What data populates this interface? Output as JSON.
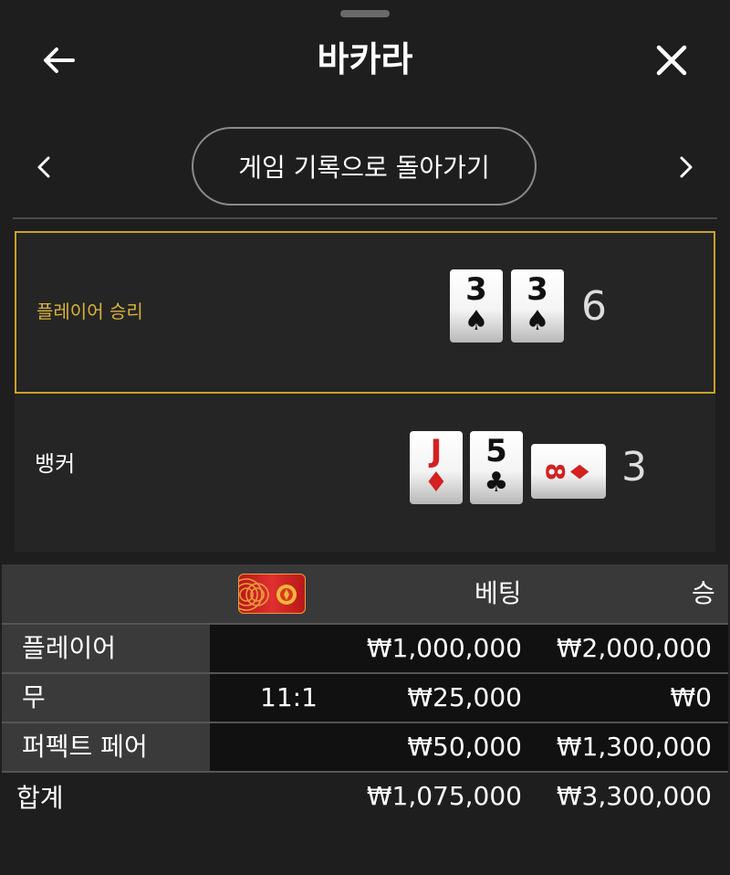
{
  "header": {
    "title": "바카라",
    "back_icon": "arrow-left-icon",
    "close_icon": "close-icon"
  },
  "navigation": {
    "prev_icon": "chevron-left-icon",
    "next_icon": "chevron-right-icon",
    "back_to_history_label": "게임 기록으로 돌아가기"
  },
  "hands": {
    "player": {
      "label": "플레이어 승리",
      "cards": [
        {
          "rank": "3",
          "suit": "♠",
          "color": "black"
        },
        {
          "rank": "3",
          "suit": "♠",
          "color": "black"
        }
      ],
      "total": "6",
      "highlight_color": "#c9a227"
    },
    "banker": {
      "label": "뱅커",
      "cards": [
        {
          "rank": "J",
          "suit": "♦",
          "color": "red"
        },
        {
          "rank": "5",
          "suit": "♣",
          "color": "black"
        },
        {
          "rank": "8",
          "suit": "♦",
          "color": "red",
          "rotated": true
        }
      ],
      "total": "3"
    }
  },
  "bets_table": {
    "columns": {
      "odds_icon": "red-envelope-chip-icon",
      "bet": "베팅",
      "win": "승"
    },
    "rows": [
      {
        "name": "플레이어",
        "odds": "",
        "bet": "₩1,000,000",
        "win": "₩2,000,000"
      },
      {
        "name": "무",
        "odds": "11:1",
        "bet": "₩25,000",
        "win": "₩0"
      },
      {
        "name": "퍼펙트 페어",
        "odds": "",
        "bet": "₩50,000",
        "win": "₩1,300,000"
      }
    ],
    "total": {
      "name": "합계",
      "bet": "₩1,075,000",
      "win": "₩3,300,000"
    }
  }
}
